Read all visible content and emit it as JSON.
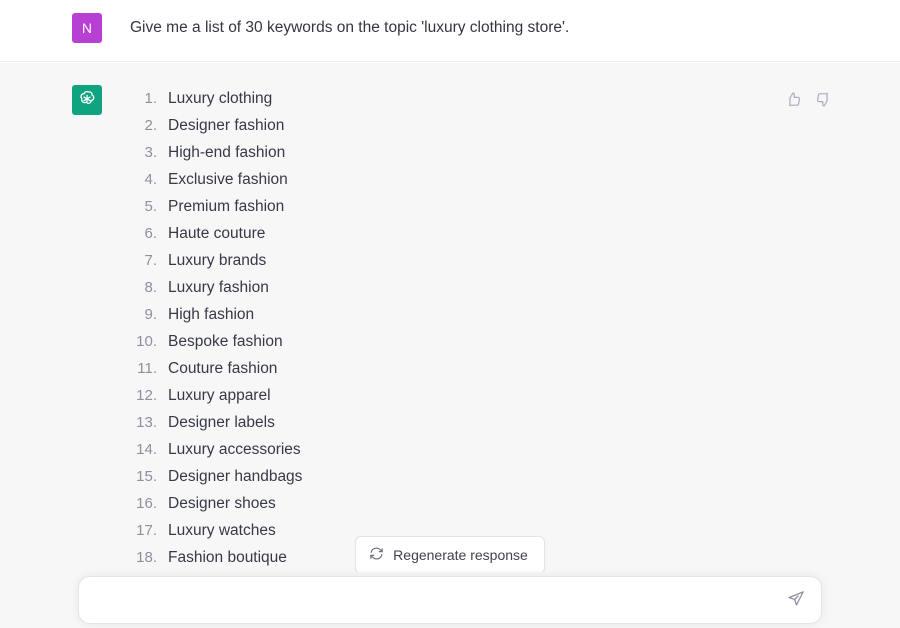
{
  "conversation": {
    "user_message": {
      "avatar_letter": "N",
      "avatar_color": "#b83fd4",
      "text": "Give me a list of 30 keywords on the topic 'luxury clothing store'."
    },
    "assistant_message": {
      "avatar_color": "#10a37f",
      "avatar_icon": "openai-logo-icon",
      "keywords": [
        "Luxury clothing",
        "Designer fashion",
        "High-end fashion",
        "Exclusive fashion",
        "Premium fashion",
        "Haute couture",
        "Luxury brands",
        "Luxury fashion",
        "High fashion",
        "Bespoke fashion",
        "Couture fashion",
        "Luxury apparel",
        "Designer labels",
        "Luxury accessories",
        "Designer handbags",
        "Designer shoes",
        "Luxury watches",
        "Fashion boutique"
      ]
    },
    "feedback": {
      "thumbs_up_icon": "thumbs-up-icon",
      "thumbs_down_icon": "thumbs-down-icon"
    }
  },
  "actions": {
    "regenerate_label": "Regenerate response",
    "regenerate_icon": "refresh-icon"
  },
  "composer": {
    "value": "",
    "placeholder": "",
    "send_icon": "send-paper-plane-icon"
  }
}
